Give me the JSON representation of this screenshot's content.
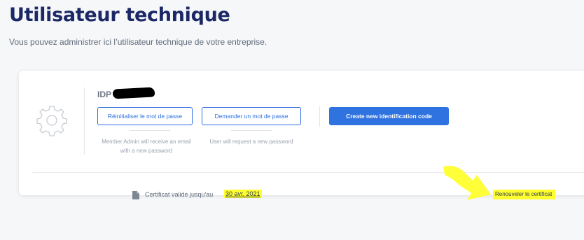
{
  "header": {
    "title": "Utilisateur technique",
    "subtitle": "Vous pouvez administrer ici l’utilisateur technique de votre entreprise."
  },
  "user": {
    "name_prefix": "IDP",
    "icon": "gear-icon"
  },
  "actions": {
    "reset_password_label": "Réinitialiser le mot de passe",
    "reset_password_hint_line1": "Member Admin will receive an email",
    "reset_password_hint_line2": "with a new password",
    "request_password_label": "Demander un mot de passe",
    "request_password_hint": "User will request a new password",
    "create_code_label": "Create new identification code"
  },
  "certificate": {
    "label": "Certificat valide jusqu'au",
    "date": "30 avr. 2021",
    "renew_label": "Renouveler le certificat",
    "icon": "document-icon"
  },
  "colors": {
    "title": "#1c2866",
    "accent": "#2f73e0",
    "highlight": "#ffff2e"
  }
}
